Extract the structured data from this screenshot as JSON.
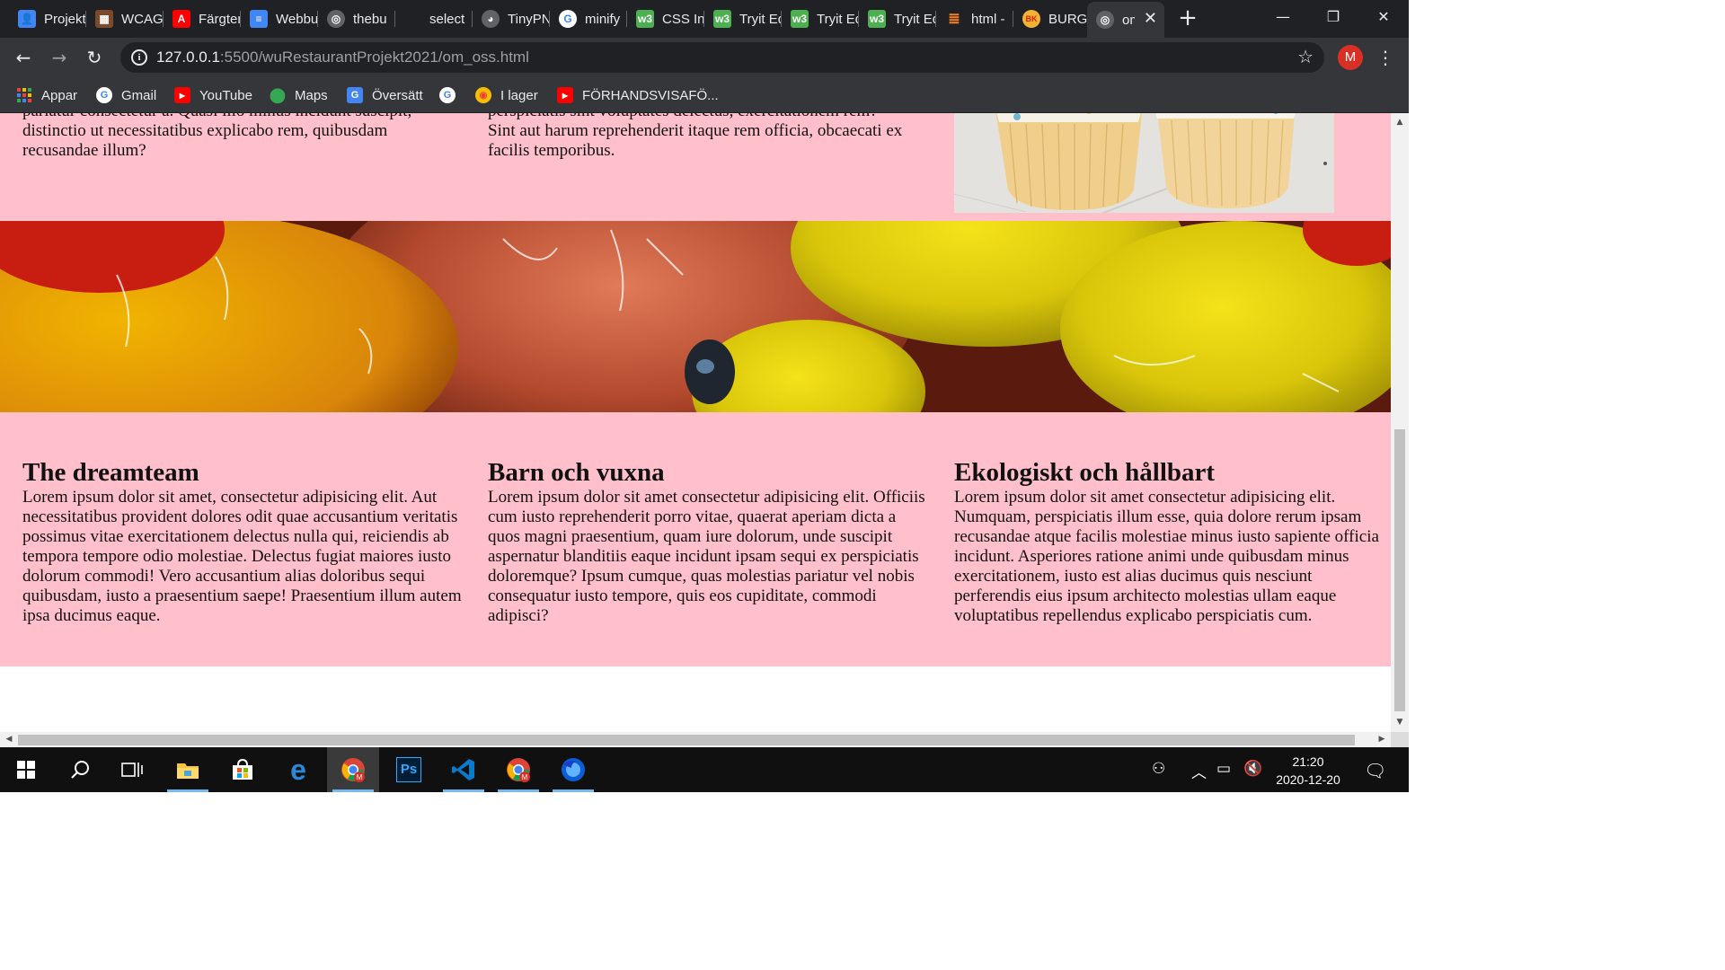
{
  "browser": {
    "tabs": [
      {
        "title": "Projekt",
        "icon": "contacts-icon",
        "color": "#4285f4"
      },
      {
        "title": "WCAG",
        "icon": "wcag-icon",
        "color": "#7b4a2a"
      },
      {
        "title": "Färgtema",
        "icon": "adobe-icon",
        "color": "#ff0000"
      },
      {
        "title": "Webbutveckling",
        "icon": "docs-icon",
        "color": "#4285f4"
      },
      {
        "title": "thebu",
        "icon": "globe-icon",
        "color": "#5f6368"
      },
      {
        "title": "select",
        "icon": "none",
        "color": "#202124"
      },
      {
        "title": "TinyPNG",
        "icon": "panda-icon",
        "color": "#5f6368"
      },
      {
        "title": "minify",
        "icon": "google-icon",
        "color": "#ffffff"
      },
      {
        "title": "CSS In",
        "icon": "w3schools-icon",
        "color": "#4caf50"
      },
      {
        "title": "Tryit Editor",
        "icon": "w3schools-icon",
        "color": "#4caf50"
      },
      {
        "title": "Tryit Editor",
        "icon": "w3schools-icon",
        "color": "#4caf50"
      },
      {
        "title": "Tryit Editor",
        "icon": "w3schools-icon",
        "color": "#4caf50"
      },
      {
        "title": "html -",
        "icon": "stackoverflow-icon",
        "color": "#f48024"
      },
      {
        "title": "BURGER",
        "icon": "burger-king-icon",
        "color": "#d62300"
      },
      {
        "title": "om_oss",
        "icon": "globe-icon",
        "color": "#5f6368",
        "active": true
      }
    ],
    "new_tab_symbol": "+",
    "window_controls": {
      "minimize": "—",
      "restore": "❐",
      "close": "✕"
    },
    "url_host": "127.0.0.1",
    "url_path": ":5500/wuRestaurantProjekt2021/om_oss.html",
    "profile_initial": "M",
    "bookmarks": [
      {
        "label": "Appar",
        "icon": "apps-grid-icon"
      },
      {
        "label": "Gmail",
        "icon": "google-icon"
      },
      {
        "label": "YouTube",
        "icon": "youtube-icon"
      },
      {
        "label": "Maps",
        "icon": "maps-pin-icon"
      },
      {
        "label": "Översätt",
        "icon": "translate-icon"
      },
      {
        "label": "",
        "icon": "google-icon"
      },
      {
        "label": "I lager",
        "icon": "chrome-icon"
      },
      {
        "label": "FÖRHANDSVISAFÖ...",
        "icon": "youtube-icon"
      }
    ]
  },
  "page": {
    "background_color": "#ffc0cb",
    "top_fragments": [
      {
        "partial_line": "pariatur consectetur a. Quasi illo minus incidunt suscipit,",
        "text": "distinctio ut necessitatibus explicabo rem, quibusdam recusandae illum?"
      },
      {
        "partial_line": "perspiciatis sint voluptates delectus, exercitationem rem?",
        "text": "Sint aut harum reprehenderit itaque rem officia, obcaecati ex facilis temporibus."
      }
    ],
    "columns": [
      {
        "heading": "The dreamteam",
        "text": "Lorem ipsum dolor sit amet, consectetur adipisicing elit. Aut necessitatibus provident dolores odit quae accusantium veritatis possimus vitae exercitationem delectus nulla qui, reiciendis ab tempora tempore odio molestiae. Delectus fugiat maiores iusto dolorum commodi! Vero accusantium alias doloribus sequi quibusdam, iusto a praesentium saepe! Praesentium illum autem ipsa ducimus eaque."
      },
      {
        "heading": "Barn och vuxna",
        "text": "Lorem ipsum dolor sit amet consectetur adipisicing elit. Officiis cum iusto reprehenderit porro vitae, quaerat aperiam dicta a quos magni praesentium, quam iure dolorum, unde suscipit aspernatur blanditiis eaque incidunt ipsam sequi ex perspiciatis doloremque? Ipsum cumque, quas molestias pariatur vel nobis consequatur iusto tempore, quis eos cupiditate, commodi adipisci?"
      },
      {
        "heading": "Ekologiskt och hållbart",
        "text": "Lorem ipsum dolor sit amet consectetur adipisicing elit. Numquam, perspiciatis illum esse, quia dolore rerum ipsam recusandae atque facilis molestiae minus iusto sapiente officia incidunt. Asperiores ratione animi unde quibusdam minus exercitationem, iusto est alias ducimus quis nesciunt perferendis eius ipsum architecto molestias ullam eaque voluptatibus repellendus explicabo perspiciatis cum."
      }
    ]
  },
  "taskbar": {
    "apps": [
      "windows-start-icon",
      "search-icon",
      "task-view-icon",
      "file-explorer-icon",
      "microsoft-store-icon",
      "edge-icon",
      "chrome-icon",
      "photoshop-icon",
      "vscode-icon",
      "chrome-icon",
      "firefox-icon"
    ],
    "photoshop_label": "Ps",
    "time": "21:20",
    "date": "2020-12-20"
  }
}
